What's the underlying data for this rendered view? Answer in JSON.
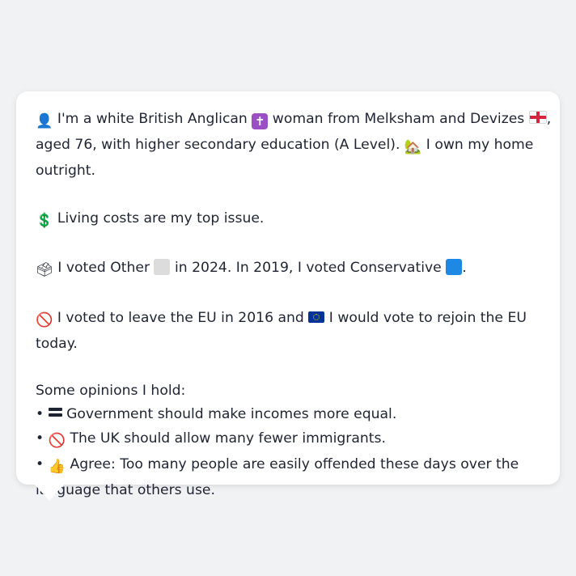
{
  "message": {
    "intro": {
      "icon": "person-silhouette-icon",
      "part1": "I'm a white British Anglican",
      "icon_cross": "latin-cross-icon",
      "part2": "woman from Melksham and Devizes",
      "icon_flag": "england-flag-icon",
      "part3": ",",
      "part4": "aged 76, with higher secondary education (A Level).",
      "icon_house": "house-icon",
      "part5": "I own my home",
      "part6": "outright."
    },
    "issue": {
      "icon": "dollar-sign-icon",
      "text": "Living costs are my top issue."
    },
    "vote": {
      "icon": "ballot-box-icon",
      "part1": "I voted Other",
      "other_color": "#dcdcdc",
      "part2": "in 2024. In 2019, I voted Conservative",
      "conservative_color": "#1e88e5",
      "part3": "."
    },
    "eu": {
      "icon": "prohibited-icon",
      "part1": "I voted to leave the EU in 2016 and",
      "icon_eu": "eu-flag-icon",
      "part2": "I would vote to rejoin the EU today."
    },
    "opinions": {
      "heading": "Some opinions I hold:",
      "bullet": "•",
      "items": [
        {
          "icon": "equals-icon",
          "text": "Government should make incomes more equal."
        },
        {
          "icon": "prohibited-icon",
          "text": "The UK should allow many fewer immigrants."
        },
        {
          "icon": "thumbs-up-icon",
          "text": "Agree: Too many people are easily offended these days over the",
          "text2": "language that others use."
        }
      ]
    }
  }
}
